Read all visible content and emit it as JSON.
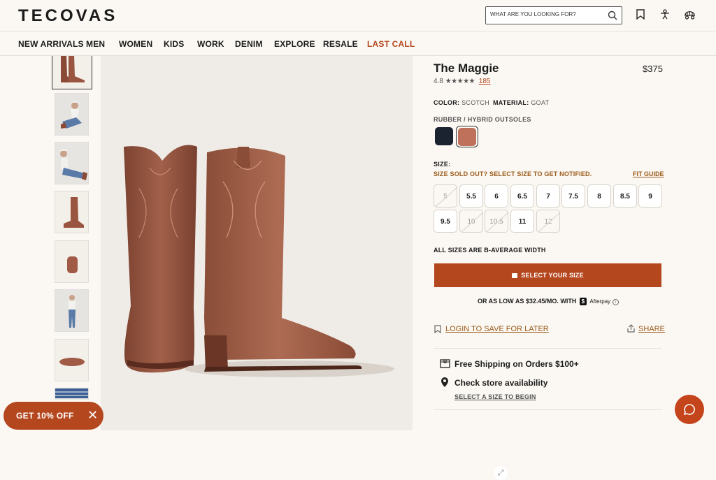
{
  "brand": "TECOVAS",
  "search": {
    "placeholder": "WHAT ARE YOU LOOKING FOR?"
  },
  "nav": [
    "NEW ARRIVALS",
    "MEN",
    "WOMEN",
    "KIDS",
    "WORK",
    "DENIM",
    "EXPLORE",
    "RESALE",
    "LAST CALL"
  ],
  "product": {
    "title": "The Maggie",
    "price": "$375",
    "rating": "4.8",
    "stars": "★★★★★",
    "review_count": "185",
    "color_label": "COLOR:",
    "color_value": "SCOTCH",
    "material_label": "MATERIAL:",
    "material_value": "GOAT",
    "outsole_label": "RUBBER / HYBRID OUTSOLES",
    "swatches": [
      {
        "name": "black",
        "color": "#1b2330"
      },
      {
        "name": "scotch",
        "color": "#c0715c"
      }
    ],
    "size_label": "SIZE:",
    "size_soldout": "SIZE SOLD OUT? SELECT SIZE TO GET NOTIFIED.",
    "fit_guide": "FIT GUIDE",
    "sizes": [
      "5",
      "5.5",
      "6",
      "6.5",
      "7",
      "7.5",
      "8",
      "8.5",
      "9",
      "9.5",
      "10",
      "10.5",
      "11",
      "12"
    ],
    "sizes_unavailable": [
      "5",
      "10",
      "10.5",
      "12"
    ],
    "width_note": "ALL SIZES ARE B-AVERAGE WIDTH",
    "cta": "SELECT YOUR SIZE",
    "afterpay_text": "OR AS LOW AS $32.45/MO. WITH",
    "afterpay_brand": "Afterpay",
    "save_later": "LOGIN TO SAVE FOR LATER",
    "share": "SHARE",
    "shipping": "Free Shipping on Orders $100+",
    "store": "Check store availability",
    "store_sub": "SELECT A SIZE TO BEGIN"
  },
  "promo": {
    "label": "GET 10% OFF",
    "close": "✕"
  },
  "colors": {
    "accent": "#b5471e",
    "link": "#9b5a1a",
    "background": "#fbf8f3"
  }
}
